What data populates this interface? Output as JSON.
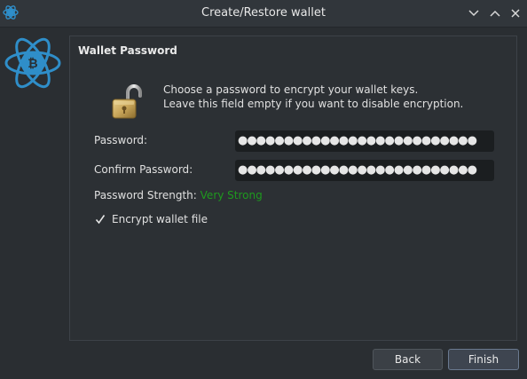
{
  "window": {
    "title": "Create/Restore wallet",
    "controls": [
      "minimize",
      "maximize",
      "close"
    ]
  },
  "page": {
    "section_title": "Wallet Password",
    "intro_line1": "Choose a password to encrypt your wallet keys.",
    "intro_line2": "Leave this field empty if you want to disable encryption.",
    "password_label": "Password:",
    "password_value": "●●●●●●●●●●●●●●●●●●●●●●●●●●",
    "confirm_label": "Confirm Password:",
    "confirm_value": "●●●●●●●●●●●●●●●●●●●●●●●●●●",
    "strength_label": "Password Strength:",
    "strength_value": "Very Strong",
    "encrypt_label": "Encrypt wallet file",
    "encrypt_checked": true
  },
  "buttons": {
    "back": "Back",
    "finish": "Finish"
  },
  "colors": {
    "strength": "#1e9a1e",
    "logo": "#2f8ec9",
    "background": "#2a2e32"
  },
  "icons": {
    "app": "electrum-logo-icon",
    "lock": "unlocked-padlock-icon"
  }
}
